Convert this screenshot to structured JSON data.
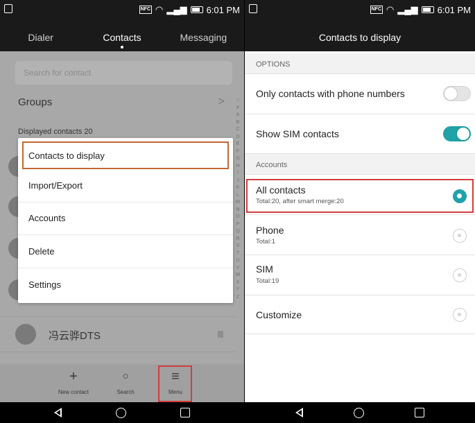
{
  "status_bar": {
    "nfc": "NFC",
    "time": "6:01 PM"
  },
  "left_screen": {
    "tabs": [
      "Dialer",
      "Contacts",
      "Messaging"
    ],
    "search_placeholder": "Search for contact",
    "groups_label": "Groups",
    "displayed_contacts": "Displayed contacts  20",
    "alphabet": [
      "☆",
      "#",
      "A",
      "B",
      "C",
      "D",
      "E",
      "F",
      "G",
      "H",
      "I",
      "J",
      "K",
      "L",
      "M",
      "N",
      "O",
      "P",
      "Q",
      "R",
      "S",
      "T",
      "U",
      "V",
      "W",
      "X",
      "Y",
      "Z"
    ],
    "visible_contact_name": "冯云骅DTS",
    "popup_menu": [
      "Contacts to display",
      "Import/Export",
      "Accounts",
      "Delete",
      "Settings"
    ],
    "bottom_bar": [
      {
        "label": "New contact",
        "icon": "plus-icon"
      },
      {
        "label": "Search",
        "icon": "search-icon"
      },
      {
        "label": "Menu",
        "icon": "menu-icon"
      }
    ]
  },
  "right_screen": {
    "title": "Contacts to display",
    "options_header": "OPTIONS",
    "options": [
      {
        "label": "Only contacts with phone numbers",
        "on": false
      },
      {
        "label": "Show SIM contacts",
        "on": true
      }
    ],
    "accounts_header": "Accounts",
    "accounts": [
      {
        "label": "All contacts",
        "sub": "Total:20,  after smart merge:20",
        "selected": true
      },
      {
        "label": "Phone",
        "sub": "Total:1",
        "selected": false
      },
      {
        "label": "SIM",
        "sub": "Total:19",
        "selected": false
      },
      {
        "label": "Customize",
        "sub": "",
        "selected": false
      }
    ]
  },
  "colors": {
    "accent": "#1fa3a8",
    "highlight_red": "#d23c3c",
    "highlight_orange": "#c0692f"
  }
}
